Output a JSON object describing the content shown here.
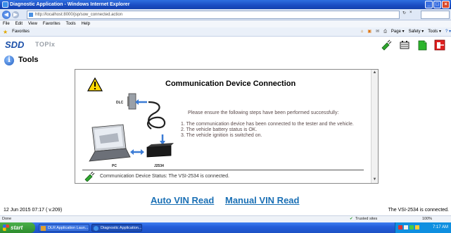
{
  "window": {
    "title": "Diagnostic Application - Windows Internet Explorer",
    "min_glyph": "_",
    "max_glyph": "□",
    "close_glyph": "×"
  },
  "browser": {
    "url": "http://localhost:8000/jsp/sow_connected.action",
    "refresh_glyph": "↻",
    "stop_glyph": "×",
    "menu": [
      "File",
      "Edit",
      "View",
      "Favorites",
      "Tools",
      "Help"
    ],
    "favorites_label": "Favorites",
    "command_items": [
      "Page ▾",
      "Safety ▾",
      "Tools ▾",
      "? ▾"
    ]
  },
  "app": {
    "logo": "SDD",
    "product": "TOPIx",
    "section_title": "Tools",
    "colors": {
      "link": "#1b70b5",
      "brand": "#1b4fa8"
    }
  },
  "dialog": {
    "title": "Communication Device Connection",
    "intro": "Please ensure the following steps have been performed successfully:",
    "steps": [
      "1. The communication device has been connected to the tester and the vehicle.",
      "2. The vehicle battery status is OK.",
      "3. The vehicle ignition is switched on."
    ],
    "labels": {
      "dlc": "DLC",
      "pc": "PC",
      "j2534": "J2534"
    },
    "status": "Communication Device Status: The VSI-2534 is connected."
  },
  "links": {
    "auto_vin": "Auto VIN Read",
    "manual_vin": "Manual VIN Read"
  },
  "status_row": {
    "left": "12 Jun 2015 07:17 ( v.209)",
    "right": "The VSI-2534 is connected."
  },
  "ie_status": {
    "left": "Done",
    "zone": "Trusted sites",
    "zoom": "100%"
  },
  "taskbar": {
    "start": "start",
    "tasks": [
      "DLR Application Laun...",
      "Diagnostic Application..."
    ],
    "clock": "7:17 AM"
  }
}
